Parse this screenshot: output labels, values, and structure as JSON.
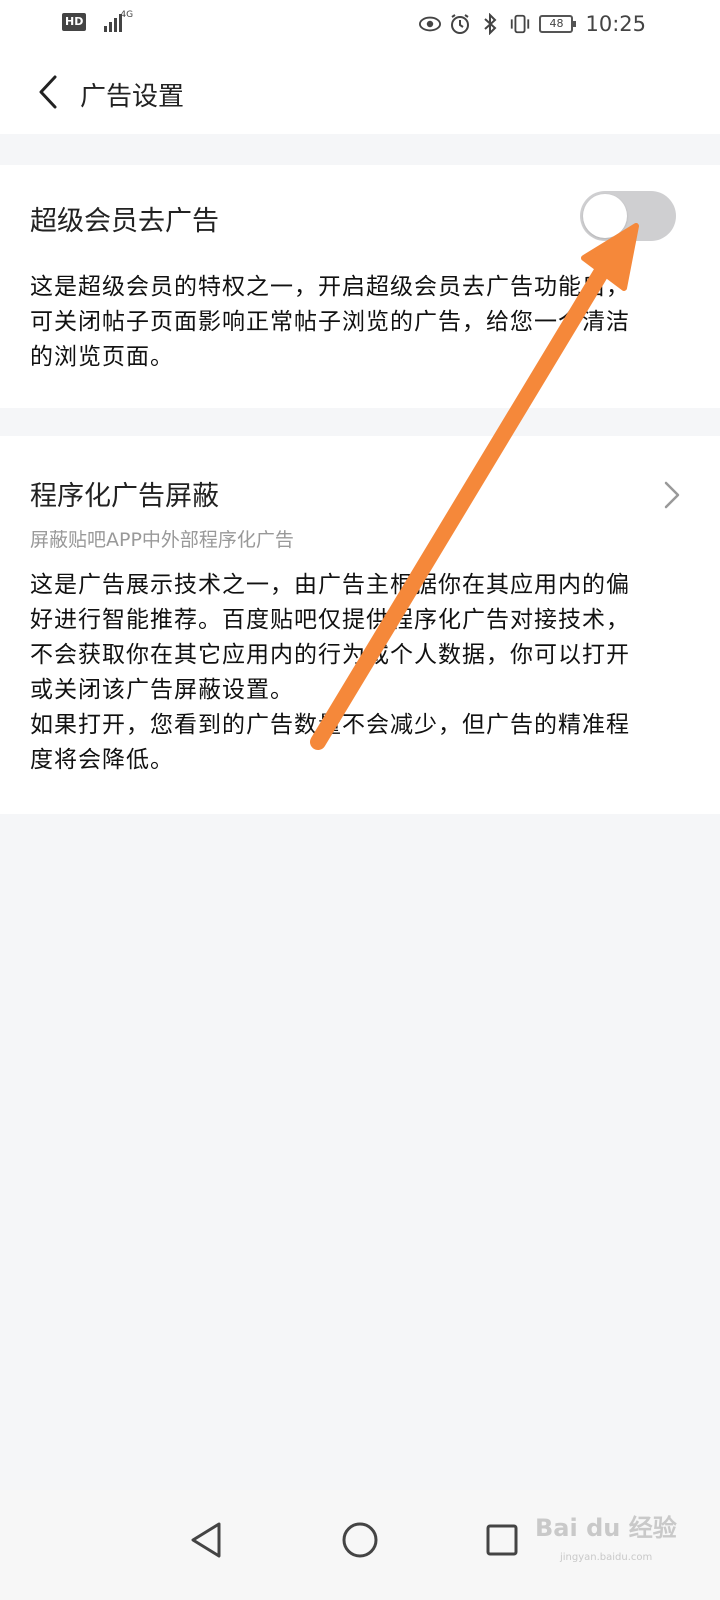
{
  "status_bar": {
    "hd": "HD",
    "network": "4G",
    "battery": "48",
    "time": "10:25",
    "icons": [
      "eye-icon",
      "alarm-icon",
      "bluetooth-icon",
      "vibrate-icon"
    ]
  },
  "header": {
    "title": "广告设置",
    "back_icon": "chevron-left-icon"
  },
  "super_member": {
    "title": "超级会员去广告",
    "toggle_on": false,
    "description": [
      "这是超级会员的特权之一，开启超级会员去广告功能后，",
      "可关闭帖子页面影响正常帖子浏览的广告，给您一个清洁",
      "的浏览页面。"
    ]
  },
  "programmatic": {
    "title": "程序化广告屏蔽",
    "subtitle": "屏蔽贴吧APP中外部程序化广告",
    "description": [
      "这是广告展示技术之一，由广告主根据你在其应用内的偏",
      "好进行智能推荐。百度贴吧仅提供程序化广告对接技术，",
      "不会获取你在其它应用内的行为或个人数据，你可以打开",
      "或关闭该广告屏蔽设置。",
      "如果打开，您看到的广告数量不会减少，但广告的精准程",
      "度将会降低。"
    ]
  },
  "watermark": {
    "brand": "Bai du 经验",
    "url": "jingyan.baidu.com"
  },
  "colors": {
    "accent_arrow": "#f5883a",
    "toggle_off": "#cfcfd1",
    "background": "#f5f6f8"
  }
}
